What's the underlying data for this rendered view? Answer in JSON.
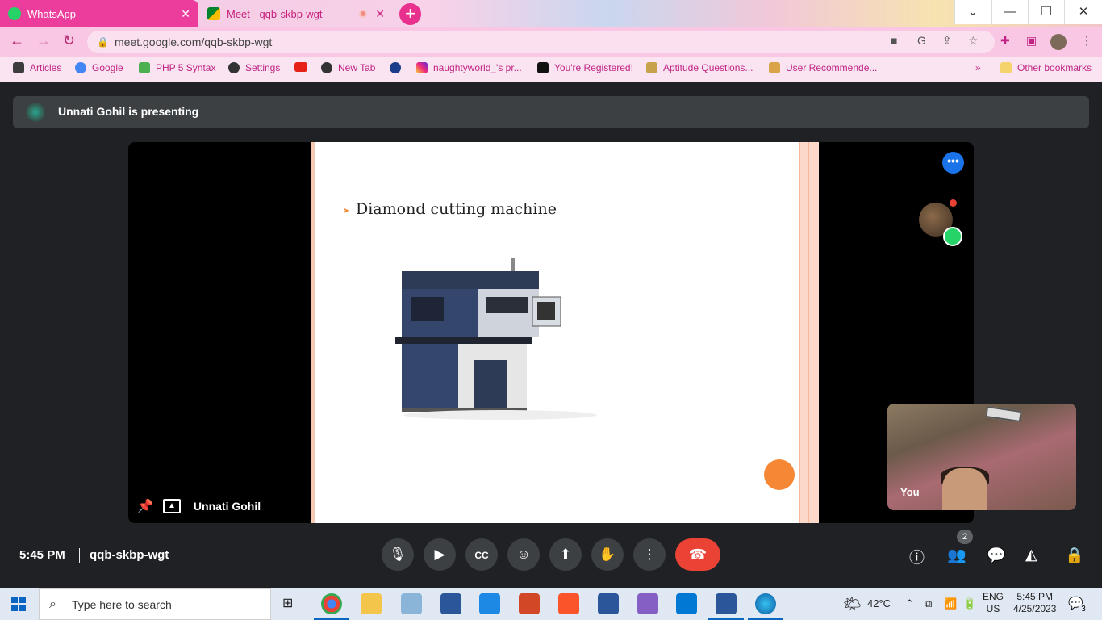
{
  "browser": {
    "tabs": [
      {
        "label": "WhatsApp",
        "active": false
      },
      {
        "label": "Meet - qqb-skbp-wgt",
        "active": true
      }
    ],
    "url": "meet.google.com/qqb-skbp-wgt",
    "bookmarks": [
      "Articles",
      "Google",
      "PHP 5 Syntax",
      "Settings",
      "New Tab",
      "naughtyworld_'s pr...",
      "You're Registered!",
      "Aptitude Questions...",
      "User Recommende...",
      "Other bookmarks"
    ]
  },
  "meet": {
    "presenting_text": "Unnati Gohil is presenting",
    "presenter_name": "Unnati Gohil",
    "slide_heading": "Diamond cutting machine",
    "self_label": "You",
    "time": "5:45 PM",
    "meeting_code": "qqb-skbp-wgt",
    "participant_count": "2"
  },
  "taskbar": {
    "search_placeholder": "Type here to search",
    "weather": "42°C",
    "lang_top": "ENG",
    "lang_bottom": "US",
    "time": "5:45 PM",
    "date": "4/25/2023",
    "notifications": "3"
  },
  "colors": {
    "whatsapp_tab": "#ec3d9c",
    "end_call": "#ea4335",
    "meet_bg": "#202124",
    "accent_blue": "#1a73e8"
  }
}
